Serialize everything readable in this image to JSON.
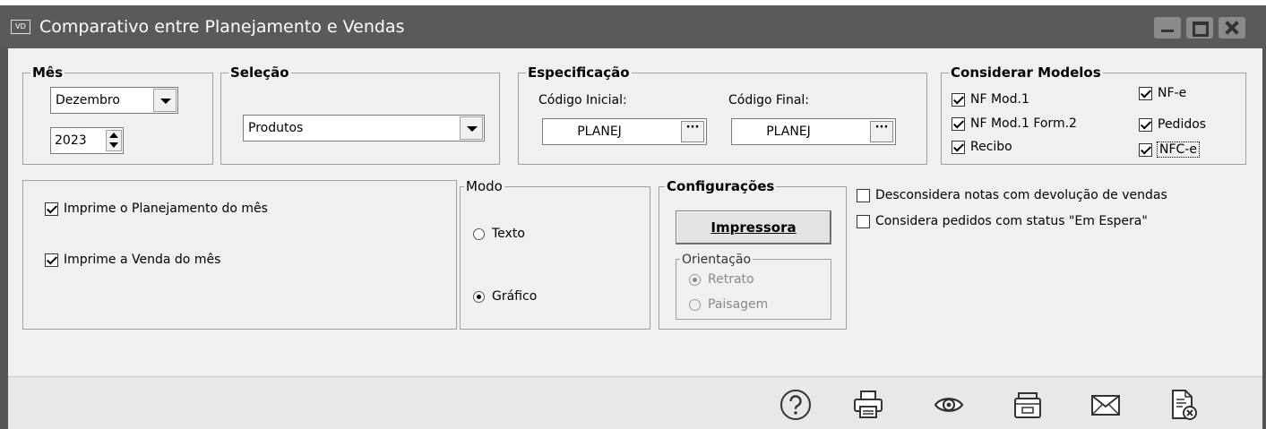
{
  "window": {
    "app_icon_text": "VD",
    "title": "Comparativo entre Planejamento e Vendas"
  },
  "mes": {
    "label": "Mês",
    "month": "Dezembro",
    "year": "2023"
  },
  "selecao": {
    "label": "Seleção",
    "value": "Produtos"
  },
  "especificacao": {
    "label": "Especificação",
    "codigo_inicial_label": "Código Inicial:",
    "codigo_inicial": "PLANEJ",
    "codigo_final_label": "Código Final:",
    "codigo_final": "PLANEJ",
    "ellipsis": "···"
  },
  "modelos": {
    "label": "Considerar Modelos",
    "items": [
      {
        "label": "NF Mod.1",
        "checked": true
      },
      {
        "label": "NF Mod.1 Form.2",
        "checked": true
      },
      {
        "label": "Recibo",
        "checked": true
      },
      {
        "label": "NF-e",
        "checked": true
      },
      {
        "label": "Pedidos",
        "checked": true
      },
      {
        "label": "NFC-e",
        "checked": true
      }
    ]
  },
  "imprime": {
    "planejamento": "Imprime o Planejamento do mês",
    "venda": "Imprime a Venda do mês"
  },
  "modo": {
    "label": "Modo",
    "texto": "Texto",
    "grafico": "Gráfico",
    "selected": "Gráfico"
  },
  "config": {
    "label": "Configurações",
    "printer_button": "Impressora",
    "orientacao_label": "Orientação",
    "retrato": "Retrato",
    "paisagem": "Paisagem",
    "selected": "Retrato"
  },
  "opcoes": {
    "desconsidera": "Desconsidera notas com devolução de vendas",
    "considera_pedidos": "Considera pedidos com status \"Em Espera\""
  },
  "footer_icons": [
    "help-icon",
    "print-icon",
    "preview-icon",
    "export-icon",
    "email-icon",
    "close-report-icon"
  ],
  "colors": {
    "titlebar": "#5a5a5a",
    "window_bg": "#f0f0f0",
    "footer_bg": "#e8e8e8"
  }
}
